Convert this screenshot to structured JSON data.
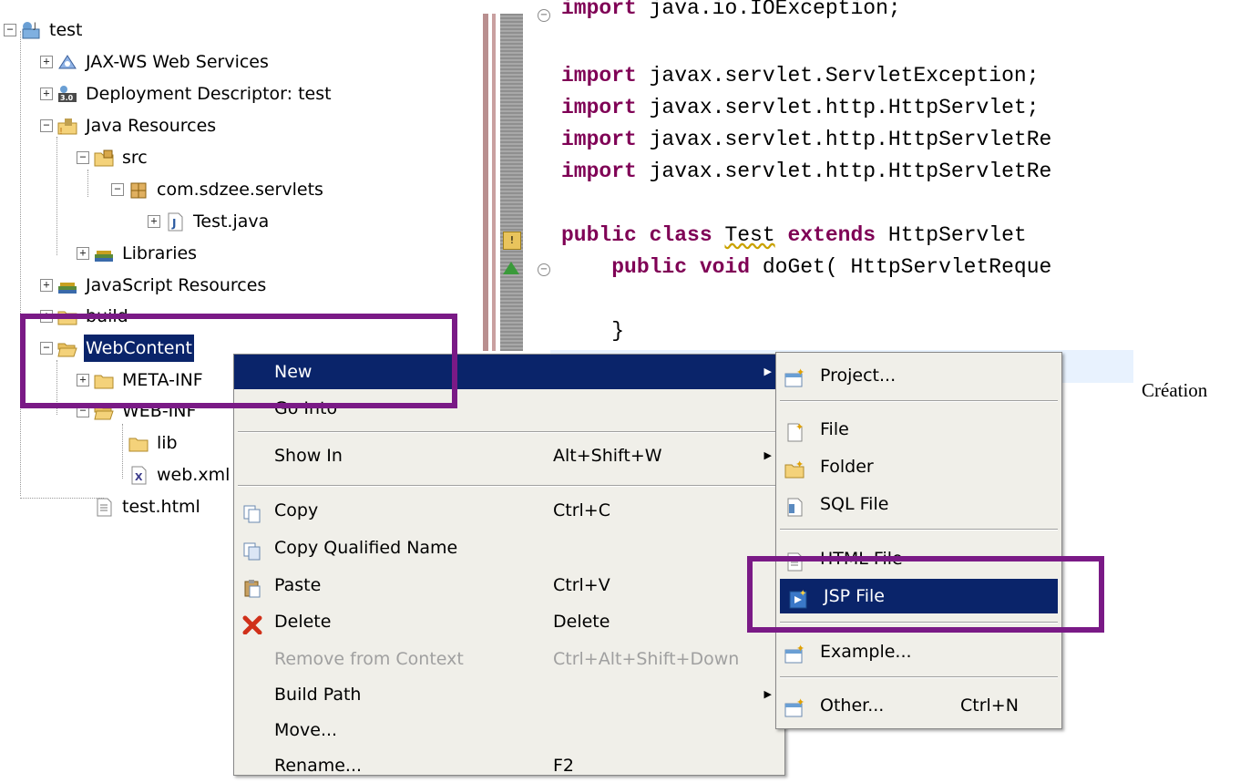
{
  "tree": {
    "items": [
      {
        "label": "test",
        "toggle": "−",
        "icon": "project-icon"
      },
      {
        "label": "JAX-WS Web Services",
        "toggle": "+",
        "icon": "web-services-icon"
      },
      {
        "label": "Deployment Descriptor: test",
        "toggle": "+",
        "icon": "deployment-descriptor-icon",
        "badge": "3.0"
      },
      {
        "label": "Java Resources",
        "toggle": "−",
        "icon": "java-resources-icon"
      },
      {
        "label": "src",
        "toggle": "−",
        "icon": "source-folder-icon"
      },
      {
        "label": "com.sdzee.servlets",
        "toggle": "−",
        "icon": "package-icon"
      },
      {
        "label": "Test.java",
        "toggle": "+",
        "icon": "java-file-icon"
      },
      {
        "label": "Libraries",
        "toggle": "+",
        "icon": "libraries-icon"
      },
      {
        "label": "JavaScript Resources",
        "toggle": "+",
        "icon": "javascript-resources-icon"
      },
      {
        "label": "build",
        "toggle": "+",
        "icon": "folder-icon"
      },
      {
        "label": "WebContent",
        "toggle": "−",
        "icon": "folder-open-icon"
      },
      {
        "label": "META-INF",
        "toggle": "+",
        "icon": "folder-icon"
      },
      {
        "label": "WEB-INF",
        "toggle": "−",
        "icon": "folder-open-icon"
      },
      {
        "label": "lib",
        "toggle": "",
        "icon": "folder-icon"
      },
      {
        "label": "web.xml",
        "toggle": "",
        "icon": "xml-file-icon"
      },
      {
        "label": "test.html",
        "toggle": "",
        "icon": "html-file-icon"
      }
    ]
  },
  "editor": {
    "lines": [
      [
        {
          "t": "import ",
          "k": true
        },
        {
          "t": "java.io.IOException;"
        }
      ],
      [
        {
          "t": "import ",
          "k": true
        },
        {
          "t": "javax.servlet.ServletException;"
        }
      ],
      [
        {
          "t": "import ",
          "k": true
        },
        {
          "t": "javax.servlet.http.HttpServlet;"
        }
      ],
      [
        {
          "t": "import ",
          "k": true
        },
        {
          "t": "javax.servlet.http.HttpServletRe"
        }
      ],
      [
        {
          "t": "import ",
          "k": true
        },
        {
          "t": "javax.servlet.http.HttpServletRe"
        }
      ],
      [
        {
          "t": "public class ",
          "k": true
        },
        {
          "t": "Test",
          "sq": true
        },
        {
          "t": " "
        },
        {
          "t": "extends ",
          "k": true
        },
        {
          "t": "HttpServlet "
        }
      ],
      [
        {
          "t": "    public void ",
          "k": true
        },
        {
          "t": "doGet( HttpServletReque"
        }
      ],
      [
        {
          "t": "    }"
        }
      ]
    ]
  },
  "context_menu": {
    "items": [
      {
        "label": "New",
        "shortcut": "",
        "arrow": "▶",
        "icon": "",
        "highlighted": true
      },
      {
        "label": "Go Into",
        "shortcut": "",
        "arrow": "",
        "icon": ""
      },
      {
        "label": "Show In",
        "shortcut": "Alt+Shift+W",
        "arrow": "▶",
        "icon": ""
      },
      {
        "label": "Copy",
        "shortcut": "Ctrl+C",
        "arrow": "",
        "icon": "copy-icon"
      },
      {
        "label": "Copy Qualified Name",
        "shortcut": "",
        "arrow": "",
        "icon": "copy-qualified-name-icon"
      },
      {
        "label": "Paste",
        "shortcut": "Ctrl+V",
        "arrow": "",
        "icon": "paste-icon"
      },
      {
        "label": "Delete",
        "shortcut": "Delete",
        "arrow": "",
        "icon": "delete-icon"
      },
      {
        "label": "Remove from Context",
        "shortcut": "Ctrl+Alt+Shift+Down",
        "arrow": "",
        "icon": "",
        "disabled": true
      },
      {
        "label": "Build Path",
        "shortcut": "",
        "arrow": "▶",
        "icon": ""
      },
      {
        "label": "Move...",
        "shortcut": "",
        "arrow": "",
        "icon": ""
      },
      {
        "label": "Rename...",
        "shortcut": "F2",
        "arrow": "",
        "icon": ""
      }
    ]
  },
  "submenu": {
    "items": [
      {
        "label": "Project...",
        "shortcut": "",
        "icon": "new-project-icon"
      },
      {
        "label": "File",
        "shortcut": "",
        "icon": "new-file-icon"
      },
      {
        "label": "Folder",
        "shortcut": "",
        "icon": "new-folder-icon"
      },
      {
        "label": "SQL File",
        "shortcut": "",
        "icon": "sql-file-icon"
      },
      {
        "label": "HTML File",
        "shortcut": "",
        "icon": "html-file-icon"
      },
      {
        "label": "JSP File",
        "shortcut": "",
        "icon": "jsp-file-icon",
        "highlighted": true
      },
      {
        "label": "Example...",
        "shortcut": "",
        "icon": "example-icon"
      },
      {
        "label": "Other...",
        "shortcut": "Ctrl+N",
        "icon": "other-wizard-icon"
      }
    ]
  },
  "caption": "Création",
  "colors": {
    "highlight": "#0a246a",
    "annotation_box": "#7a1a86",
    "keyword": "#7f0055",
    "menu_bg": "#f0efe9"
  }
}
